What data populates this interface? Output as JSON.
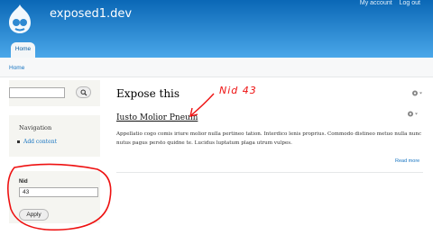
{
  "header": {
    "site_name": "exposed1.dev",
    "secondary_menu": [
      "My account",
      "Log out"
    ],
    "tab_home": "Home",
    "background_color": "#0a67b6"
  },
  "breadcrumb": {
    "home": "Home"
  },
  "sidebar": {
    "search": {
      "placeholder": "",
      "button_icon": "search-icon"
    },
    "navigation": {
      "title": "Navigation",
      "items": [
        {
          "label": "Add content"
        }
      ]
    },
    "filter": {
      "label": "Nid",
      "value": "43",
      "apply_label": "Apply"
    }
  },
  "main": {
    "page_title": "Expose this",
    "node": {
      "title": "Iusto Molior Pneum",
      "body": "Appellatio cogo comis iriure molior nulla pertineo tation. Interdico lenis proprius. Commodo distineo metuo nulla nunc nutus pagus persto quidne te. Lucidus luptatum plaga utrum vulpes.",
      "read_more": "Read more"
    }
  },
  "annotation": {
    "text": "Nid 43",
    "color": "#e11"
  }
}
